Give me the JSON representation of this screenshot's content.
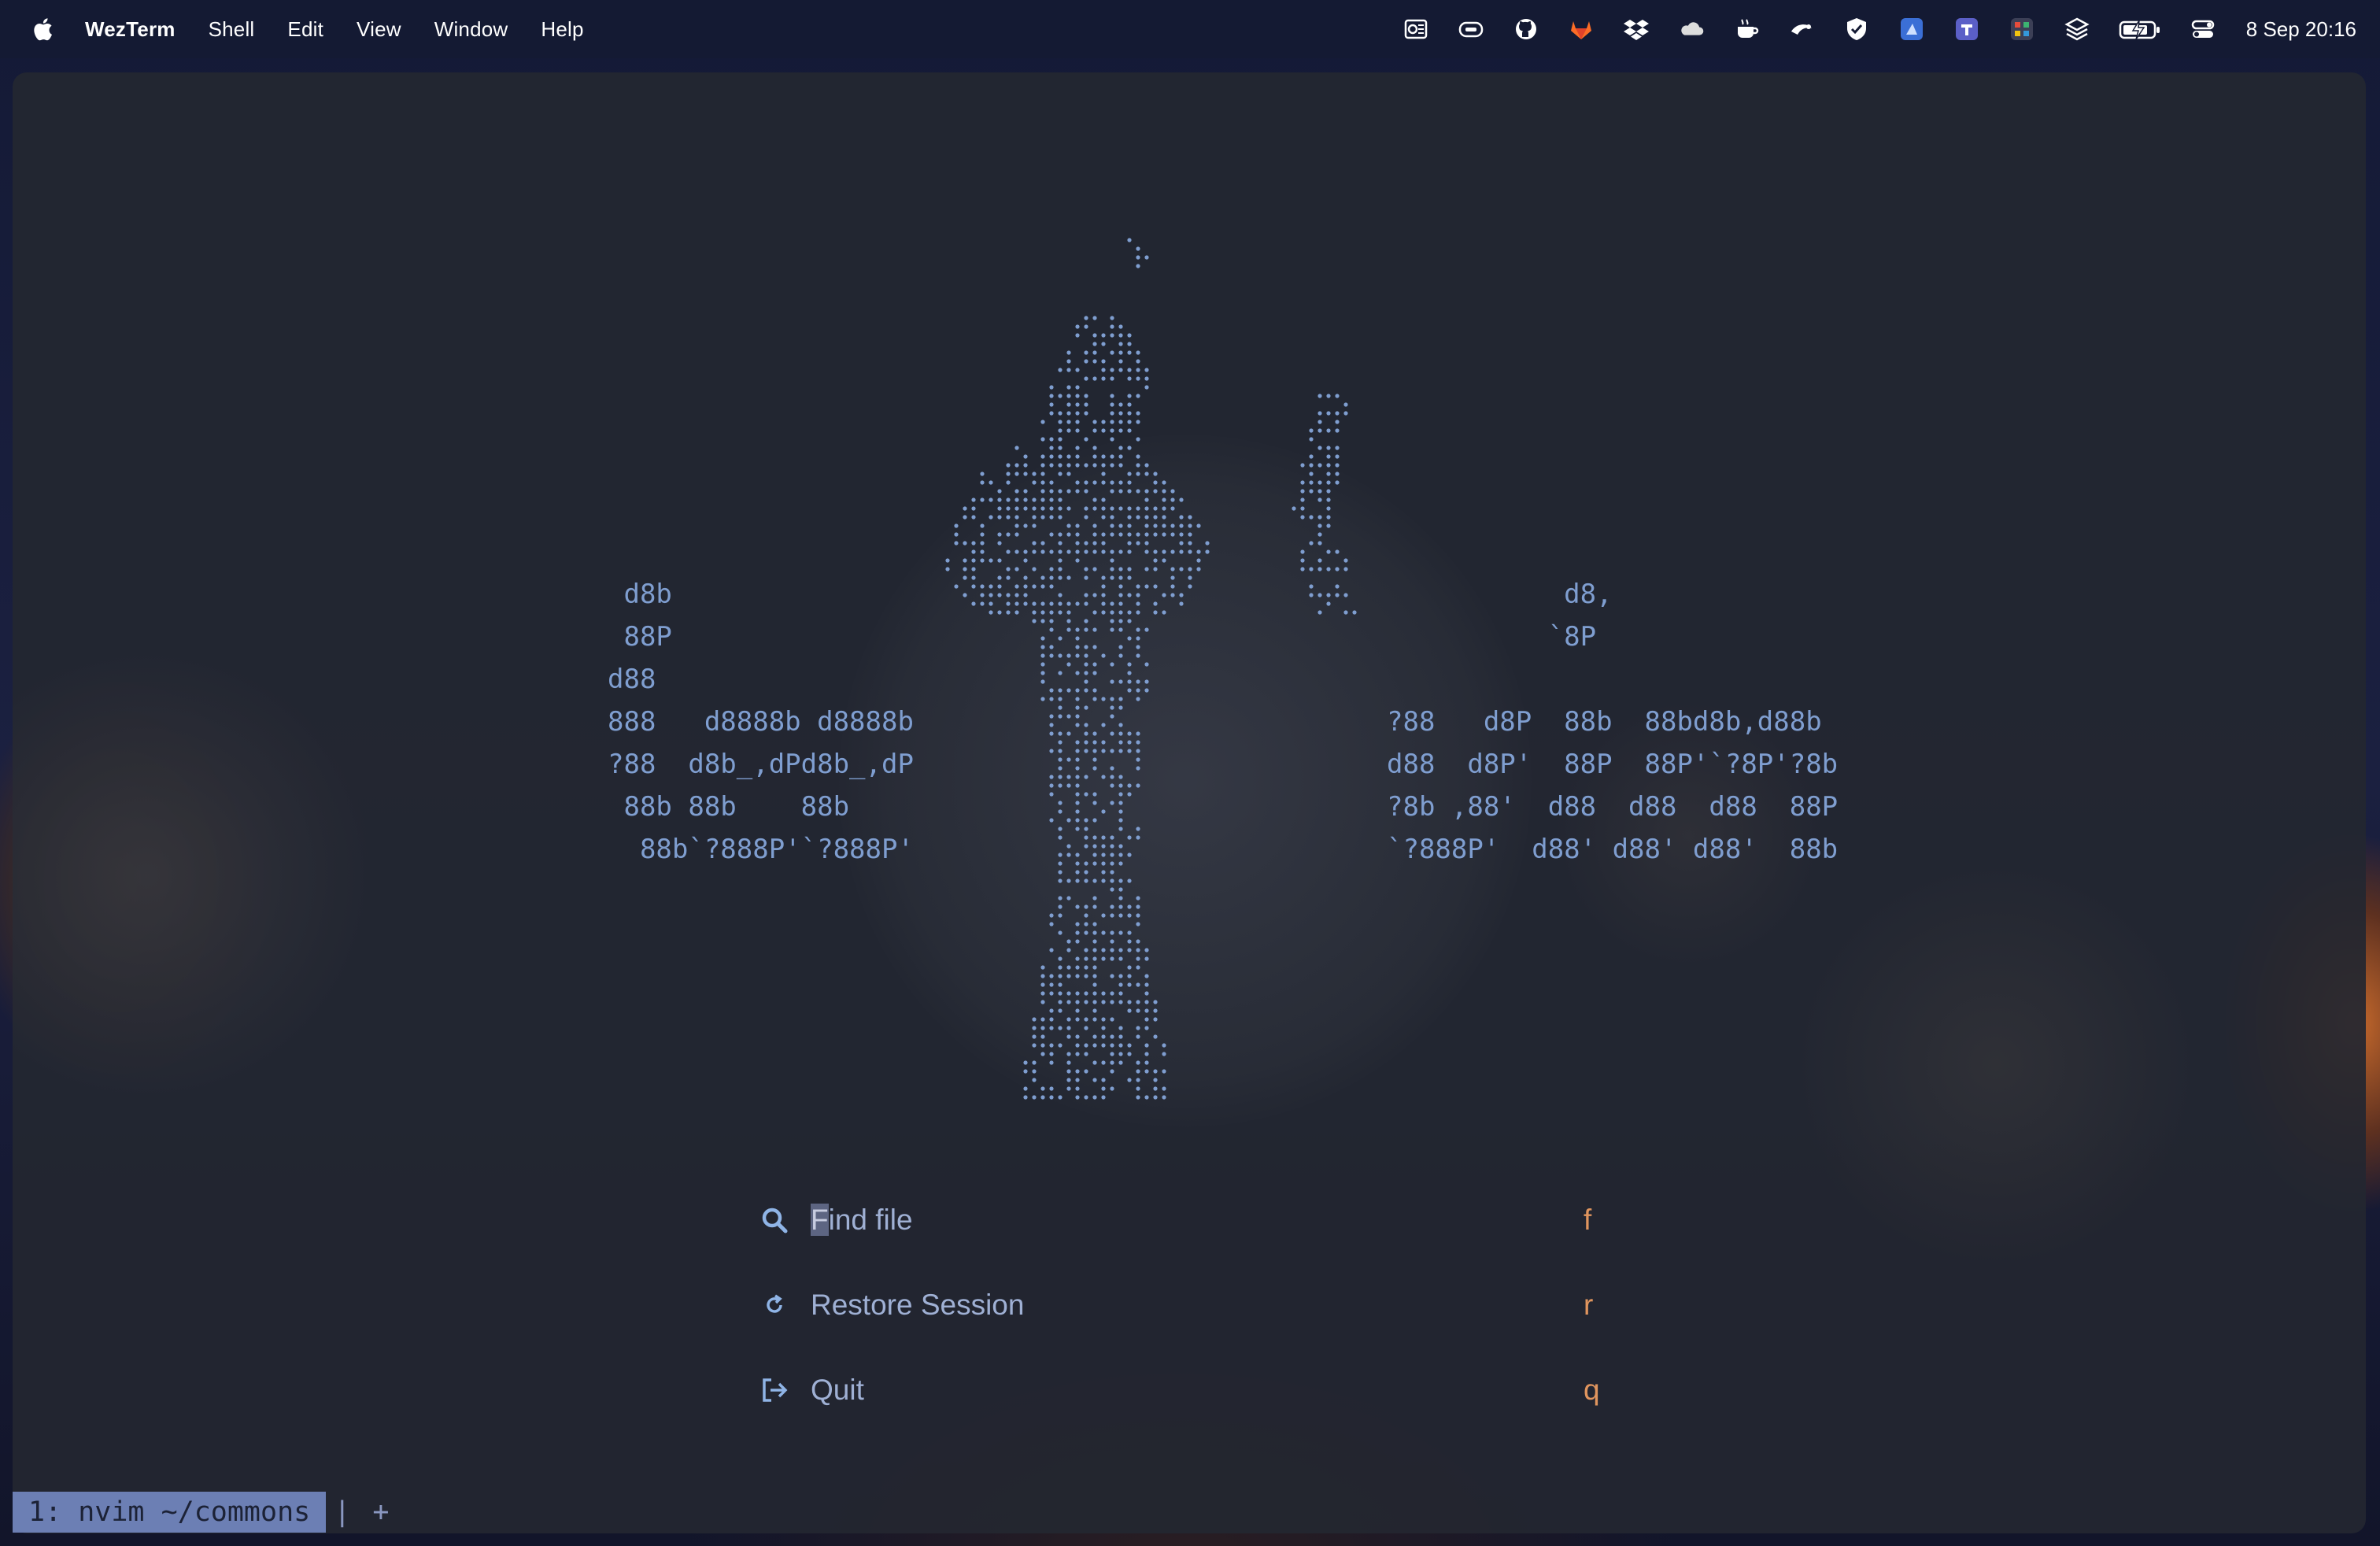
{
  "menubar": {
    "app_name": "WezTerm",
    "menus": [
      "Shell",
      "Edit",
      "View",
      "Window",
      "Help"
    ],
    "status_icons": [
      "outlook-icon",
      "screen-icon",
      "github-icon",
      "gitlab-icon",
      "dropbox-icon",
      "icloud-icon",
      "amphetamine-icon",
      "scroll-icon",
      "shield-icon",
      "app-icon",
      "teams-icon",
      "grid-app-icon",
      "layers-icon",
      "battery-icon",
      "control-center-icon"
    ],
    "clock": "8 Sep  20:16"
  },
  "dashboard": {
    "logo_left": " d8b\n 88P\nd88\n888   d8888b d8888b\n?88  d8b_,dPd8b_,dP\n 88b 88b    88b\n  88b`?888P'`?888P'",
    "logo_right": "           d8,\n          `8P\n\n?88   d8P  88b  88bd8b,d88b\nd88  d8P'  88P  88P'`?8P'?8b\n?8b ,88'  d88  d88  d88  88P\n`?888P'  d88' d88' d88'  88b",
    "colors": {
      "ascii": "#7f9ed0",
      "key": "#e0955e",
      "label": "#9fb0d4"
    },
    "actions": [
      {
        "icon": "search-icon",
        "cursor_char": "F",
        "label": "ind file",
        "key": "f"
      },
      {
        "icon": "refresh-icon",
        "label": "Restore Session",
        "key": "r"
      },
      {
        "icon": "logout-icon",
        "label": "Quit",
        "key": "q"
      }
    ]
  },
  "tabbar": {
    "active_tab": "1: nvim  ~/commons",
    "separator": "|",
    "new_tab": "+"
  }
}
